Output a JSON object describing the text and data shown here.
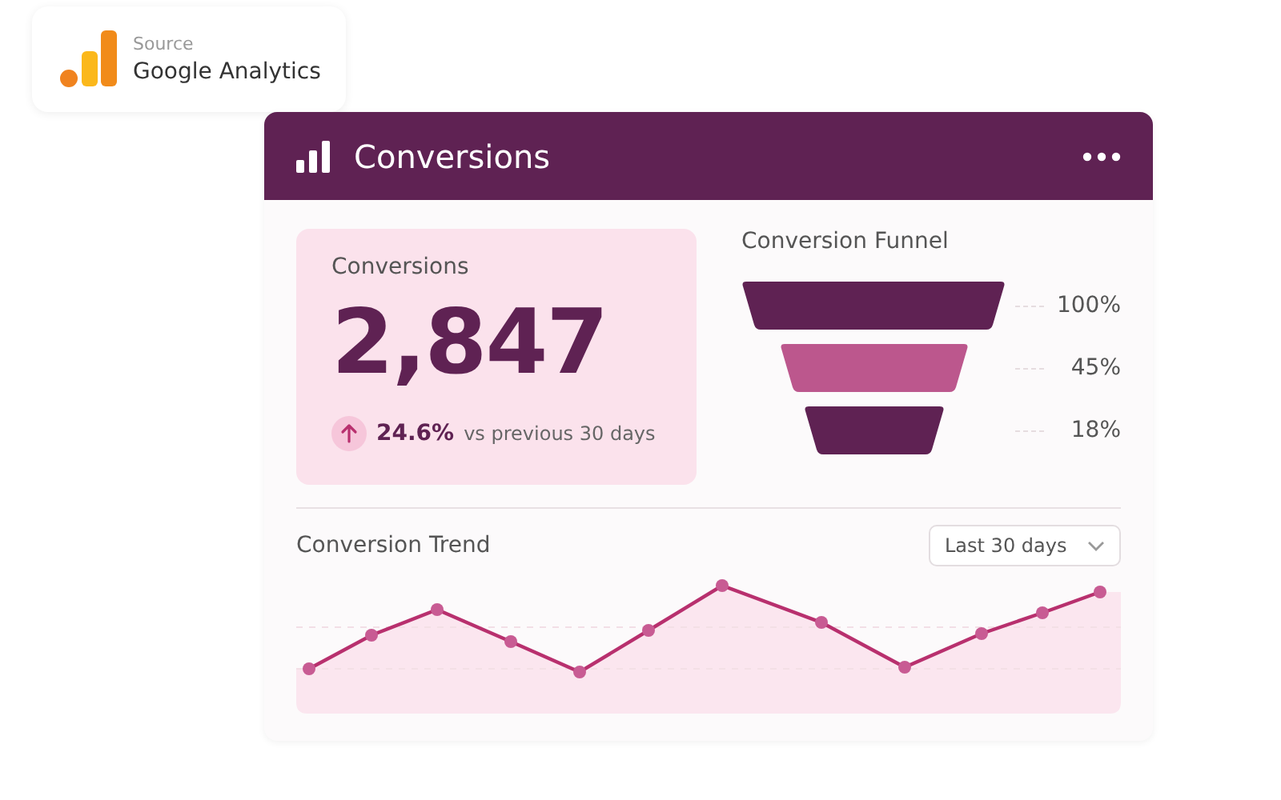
{
  "source": {
    "label": "Source",
    "name": "Google Analytics"
  },
  "card": {
    "title": "Conversions"
  },
  "kpi": {
    "label": "Conversions",
    "value": "2,847",
    "change": "24.6%",
    "comparison": "vs previous 30 days"
  },
  "funnel": {
    "title": "Conversion Funnel",
    "stages": [
      {
        "label": "100%",
        "kind": "dark"
      },
      {
        "label": "45%",
        "kind": "light"
      },
      {
        "label": "18%",
        "kind": "dark"
      }
    ]
  },
  "trend": {
    "title": "Conversion Trend",
    "range": "Last 30 days"
  }
}
